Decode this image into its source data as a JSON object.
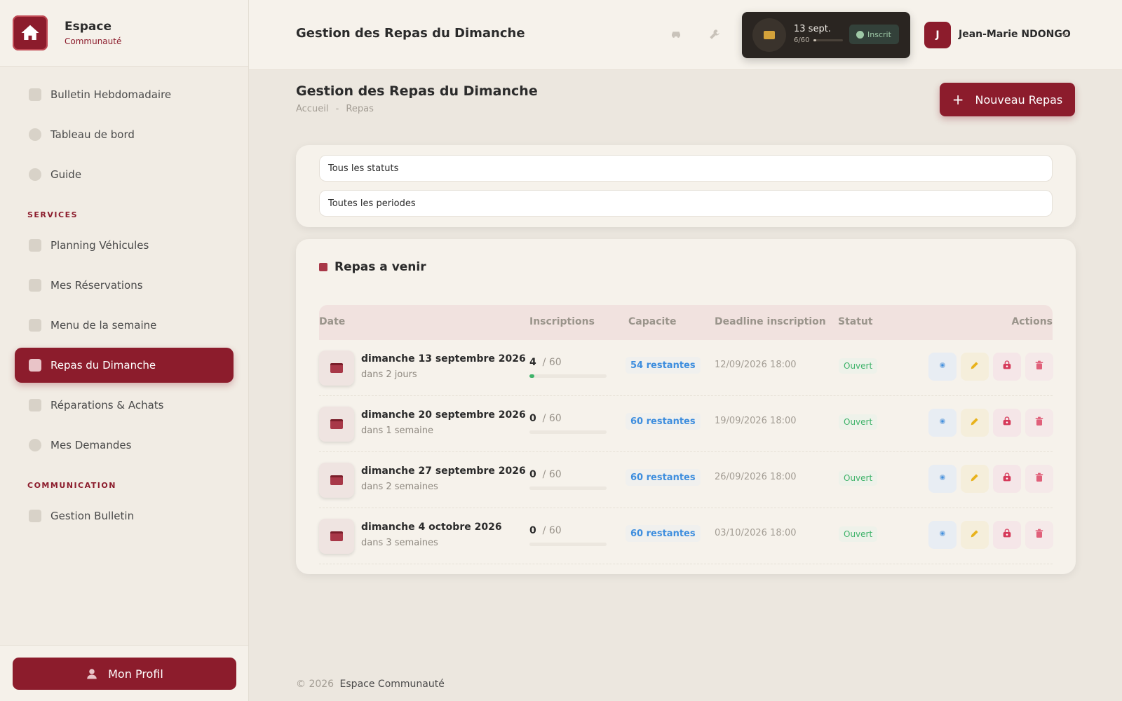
{
  "brand": {
    "name": "Espace",
    "subtitle": "Communauté"
  },
  "sidebar": {
    "items_top": [
      {
        "label": "Bulletin Hebdomadaire",
        "icon": "document-icon"
      },
      {
        "label": "Tableau de bord",
        "icon": "dashboard-icon"
      },
      {
        "label": "Guide",
        "icon": "info-icon"
      }
    ],
    "section_services": "SERVICES",
    "items_services": [
      {
        "label": "Planning Véhicules",
        "icon": "tools-icon"
      },
      {
        "label": "Mes Réservations",
        "icon": "car-icon"
      },
      {
        "label": "Menu de la semaine",
        "icon": "menu-icon"
      },
      {
        "label": "Repas du Dimanche",
        "icon": "meal-icon",
        "active": true
      },
      {
        "label": "Réparations & Achats",
        "icon": "list-icon"
      },
      {
        "label": "Mes Demandes",
        "icon": "request-icon"
      }
    ],
    "section_communication": "COMMUNICATION",
    "items_communication": [
      {
        "label": "Gestion Bulletin",
        "icon": "document-icon"
      }
    ],
    "profile_button": "Mon Profil"
  },
  "header": {
    "title": "Gestion des Repas du Dimanche",
    "widget": {
      "date": "13 sept.",
      "count": "6/60",
      "progress": 0.1,
      "badge": "Inscrit"
    },
    "user": {
      "initial": "J",
      "name": "Jean-Marie NDONGO"
    }
  },
  "page": {
    "title": "Gestion des Repas du Dimanche",
    "breadcrumb": [
      "Accueil",
      "-",
      "Repas"
    ],
    "new_button": "Nouveau Repas"
  },
  "filters": {
    "status": "Tous les statuts",
    "period": "Toutes les periodes"
  },
  "table": {
    "title": "Repas a venir",
    "columns": [
      "Date",
      "Inscriptions",
      "Capacite",
      "Deadline inscription",
      "Statut",
      "Actions"
    ],
    "rows": [
      {
        "date": "dimanche 13 septembre 2026",
        "relative": "dans 2 jours",
        "count": "4",
        "total": "/ 60",
        "fill": 0.067,
        "capacity": "54 restantes",
        "deadline": "12/09/2026 18:00",
        "status": "Ouvert"
      },
      {
        "date": "dimanche 20 septembre 2026",
        "relative": "dans 1 semaine",
        "count": "0",
        "total": "/ 60",
        "fill": 0,
        "capacity": "60 restantes",
        "deadline": "19/09/2026 18:00",
        "status": "Ouvert"
      },
      {
        "date": "dimanche 27 septembre 2026",
        "relative": "dans 2 semaines",
        "count": "0",
        "total": "/ 60",
        "fill": 0,
        "capacity": "60 restantes",
        "deadline": "26/09/2026 18:00",
        "status": "Ouvert"
      },
      {
        "date": "dimanche 4 octobre 2026",
        "relative": "dans 3 semaines",
        "count": "0",
        "total": "/ 60",
        "fill": 0,
        "capacity": "60 restantes",
        "deadline": "03/10/2026 18:00",
        "status": "Ouvert"
      }
    ]
  },
  "footer": {
    "copyright": "© 2026",
    "name": "Espace Communauté"
  },
  "colors": {
    "accent": "#8c1c2c",
    "success": "#3fb36a",
    "info": "#3e8ede"
  }
}
